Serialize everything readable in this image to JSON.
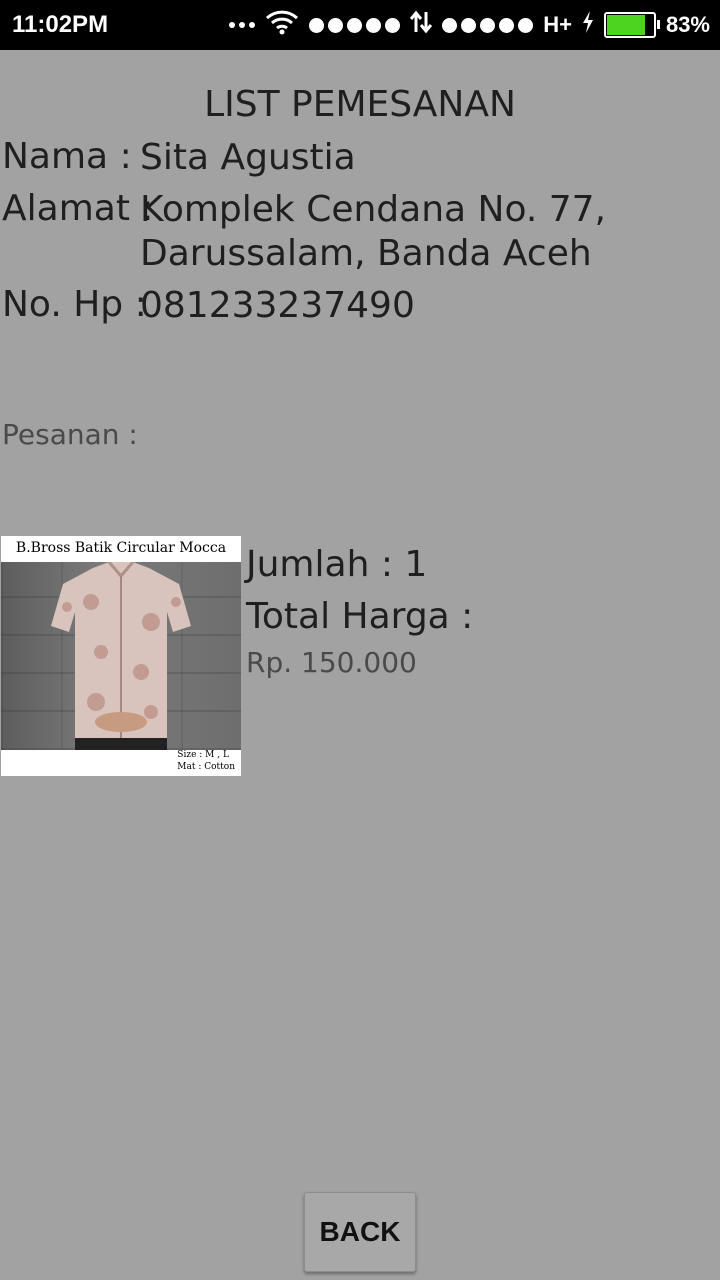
{
  "status_bar": {
    "time": "11:02PM",
    "network": "H+",
    "battery_percent_text": "83%",
    "battery_level": 0.83,
    "icons": [
      "more-dots-icon",
      "wifi-icon",
      "signal-dots-icon",
      "data-transfer-icon",
      "signal-dots-icon",
      "charging-icon",
      "battery-icon"
    ],
    "battery_color": "#4cd41f"
  },
  "page": {
    "title": "LIST PEMESANAN",
    "background_color": "#a2a2a2"
  },
  "customer": {
    "name_label": "Nama :",
    "name_value": "Sita Agustia",
    "address_label": "Alamat :",
    "address_line1": "Komplek Cendana No. 77,",
    "address_line2": "Darussalam, Banda Aceh",
    "phone_label": "No. Hp :",
    "phone_value": "081233237490"
  },
  "order": {
    "section_label": "Pesanan :",
    "product_image": {
      "title": "B.Bross Batik Circular Mocca",
      "size_text": "Size : M , L",
      "material_text": "Mat : Cotton"
    },
    "quantity_text": "Jumlah :  1",
    "total_label": "Total Harga :",
    "price": "Rp. 150.000"
  },
  "actions": {
    "back_label": "BACK"
  }
}
